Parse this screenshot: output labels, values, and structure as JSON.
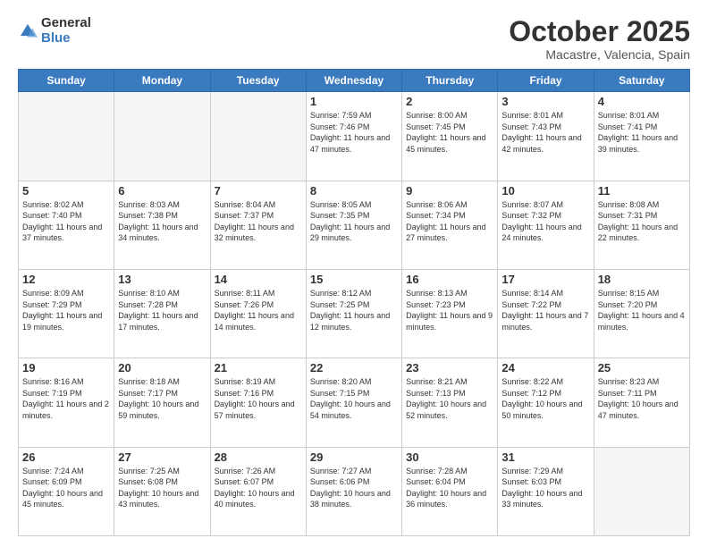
{
  "logo": {
    "general": "General",
    "blue": "Blue"
  },
  "header": {
    "month": "October 2025",
    "location": "Macastre, Valencia, Spain"
  },
  "weekdays": [
    "Sunday",
    "Monday",
    "Tuesday",
    "Wednesday",
    "Thursday",
    "Friday",
    "Saturday"
  ],
  "weeks": [
    [
      {
        "day": "",
        "info": ""
      },
      {
        "day": "",
        "info": ""
      },
      {
        "day": "",
        "info": ""
      },
      {
        "day": "1",
        "info": "Sunrise: 7:59 AM\nSunset: 7:46 PM\nDaylight: 11 hours\nand 47 minutes."
      },
      {
        "day": "2",
        "info": "Sunrise: 8:00 AM\nSunset: 7:45 PM\nDaylight: 11 hours\nand 45 minutes."
      },
      {
        "day": "3",
        "info": "Sunrise: 8:01 AM\nSunset: 7:43 PM\nDaylight: 11 hours\nand 42 minutes."
      },
      {
        "day": "4",
        "info": "Sunrise: 8:01 AM\nSunset: 7:41 PM\nDaylight: 11 hours\nand 39 minutes."
      }
    ],
    [
      {
        "day": "5",
        "info": "Sunrise: 8:02 AM\nSunset: 7:40 PM\nDaylight: 11 hours\nand 37 minutes."
      },
      {
        "day": "6",
        "info": "Sunrise: 8:03 AM\nSunset: 7:38 PM\nDaylight: 11 hours\nand 34 minutes."
      },
      {
        "day": "7",
        "info": "Sunrise: 8:04 AM\nSunset: 7:37 PM\nDaylight: 11 hours\nand 32 minutes."
      },
      {
        "day": "8",
        "info": "Sunrise: 8:05 AM\nSunset: 7:35 PM\nDaylight: 11 hours\nand 29 minutes."
      },
      {
        "day": "9",
        "info": "Sunrise: 8:06 AM\nSunset: 7:34 PM\nDaylight: 11 hours\nand 27 minutes."
      },
      {
        "day": "10",
        "info": "Sunrise: 8:07 AM\nSunset: 7:32 PM\nDaylight: 11 hours\nand 24 minutes."
      },
      {
        "day": "11",
        "info": "Sunrise: 8:08 AM\nSunset: 7:31 PM\nDaylight: 11 hours\nand 22 minutes."
      }
    ],
    [
      {
        "day": "12",
        "info": "Sunrise: 8:09 AM\nSunset: 7:29 PM\nDaylight: 11 hours\nand 19 minutes."
      },
      {
        "day": "13",
        "info": "Sunrise: 8:10 AM\nSunset: 7:28 PM\nDaylight: 11 hours\nand 17 minutes."
      },
      {
        "day": "14",
        "info": "Sunrise: 8:11 AM\nSunset: 7:26 PM\nDaylight: 11 hours\nand 14 minutes."
      },
      {
        "day": "15",
        "info": "Sunrise: 8:12 AM\nSunset: 7:25 PM\nDaylight: 11 hours\nand 12 minutes."
      },
      {
        "day": "16",
        "info": "Sunrise: 8:13 AM\nSunset: 7:23 PM\nDaylight: 11 hours\nand 9 minutes."
      },
      {
        "day": "17",
        "info": "Sunrise: 8:14 AM\nSunset: 7:22 PM\nDaylight: 11 hours\nand 7 minutes."
      },
      {
        "day": "18",
        "info": "Sunrise: 8:15 AM\nSunset: 7:20 PM\nDaylight: 11 hours\nand 4 minutes."
      }
    ],
    [
      {
        "day": "19",
        "info": "Sunrise: 8:16 AM\nSunset: 7:19 PM\nDaylight: 11 hours\nand 2 minutes."
      },
      {
        "day": "20",
        "info": "Sunrise: 8:18 AM\nSunset: 7:17 PM\nDaylight: 10 hours\nand 59 minutes."
      },
      {
        "day": "21",
        "info": "Sunrise: 8:19 AM\nSunset: 7:16 PM\nDaylight: 10 hours\nand 57 minutes."
      },
      {
        "day": "22",
        "info": "Sunrise: 8:20 AM\nSunset: 7:15 PM\nDaylight: 10 hours\nand 54 minutes."
      },
      {
        "day": "23",
        "info": "Sunrise: 8:21 AM\nSunset: 7:13 PM\nDaylight: 10 hours\nand 52 minutes."
      },
      {
        "day": "24",
        "info": "Sunrise: 8:22 AM\nSunset: 7:12 PM\nDaylight: 10 hours\nand 50 minutes."
      },
      {
        "day": "25",
        "info": "Sunrise: 8:23 AM\nSunset: 7:11 PM\nDaylight: 10 hours\nand 47 minutes."
      }
    ],
    [
      {
        "day": "26",
        "info": "Sunrise: 7:24 AM\nSunset: 6:09 PM\nDaylight: 10 hours\nand 45 minutes."
      },
      {
        "day": "27",
        "info": "Sunrise: 7:25 AM\nSunset: 6:08 PM\nDaylight: 10 hours\nand 43 minutes."
      },
      {
        "day": "28",
        "info": "Sunrise: 7:26 AM\nSunset: 6:07 PM\nDaylight: 10 hours\nand 40 minutes."
      },
      {
        "day": "29",
        "info": "Sunrise: 7:27 AM\nSunset: 6:06 PM\nDaylight: 10 hours\nand 38 minutes."
      },
      {
        "day": "30",
        "info": "Sunrise: 7:28 AM\nSunset: 6:04 PM\nDaylight: 10 hours\nand 36 minutes."
      },
      {
        "day": "31",
        "info": "Sunrise: 7:29 AM\nSunset: 6:03 PM\nDaylight: 10 hours\nand 33 minutes."
      },
      {
        "day": "",
        "info": ""
      }
    ]
  ]
}
